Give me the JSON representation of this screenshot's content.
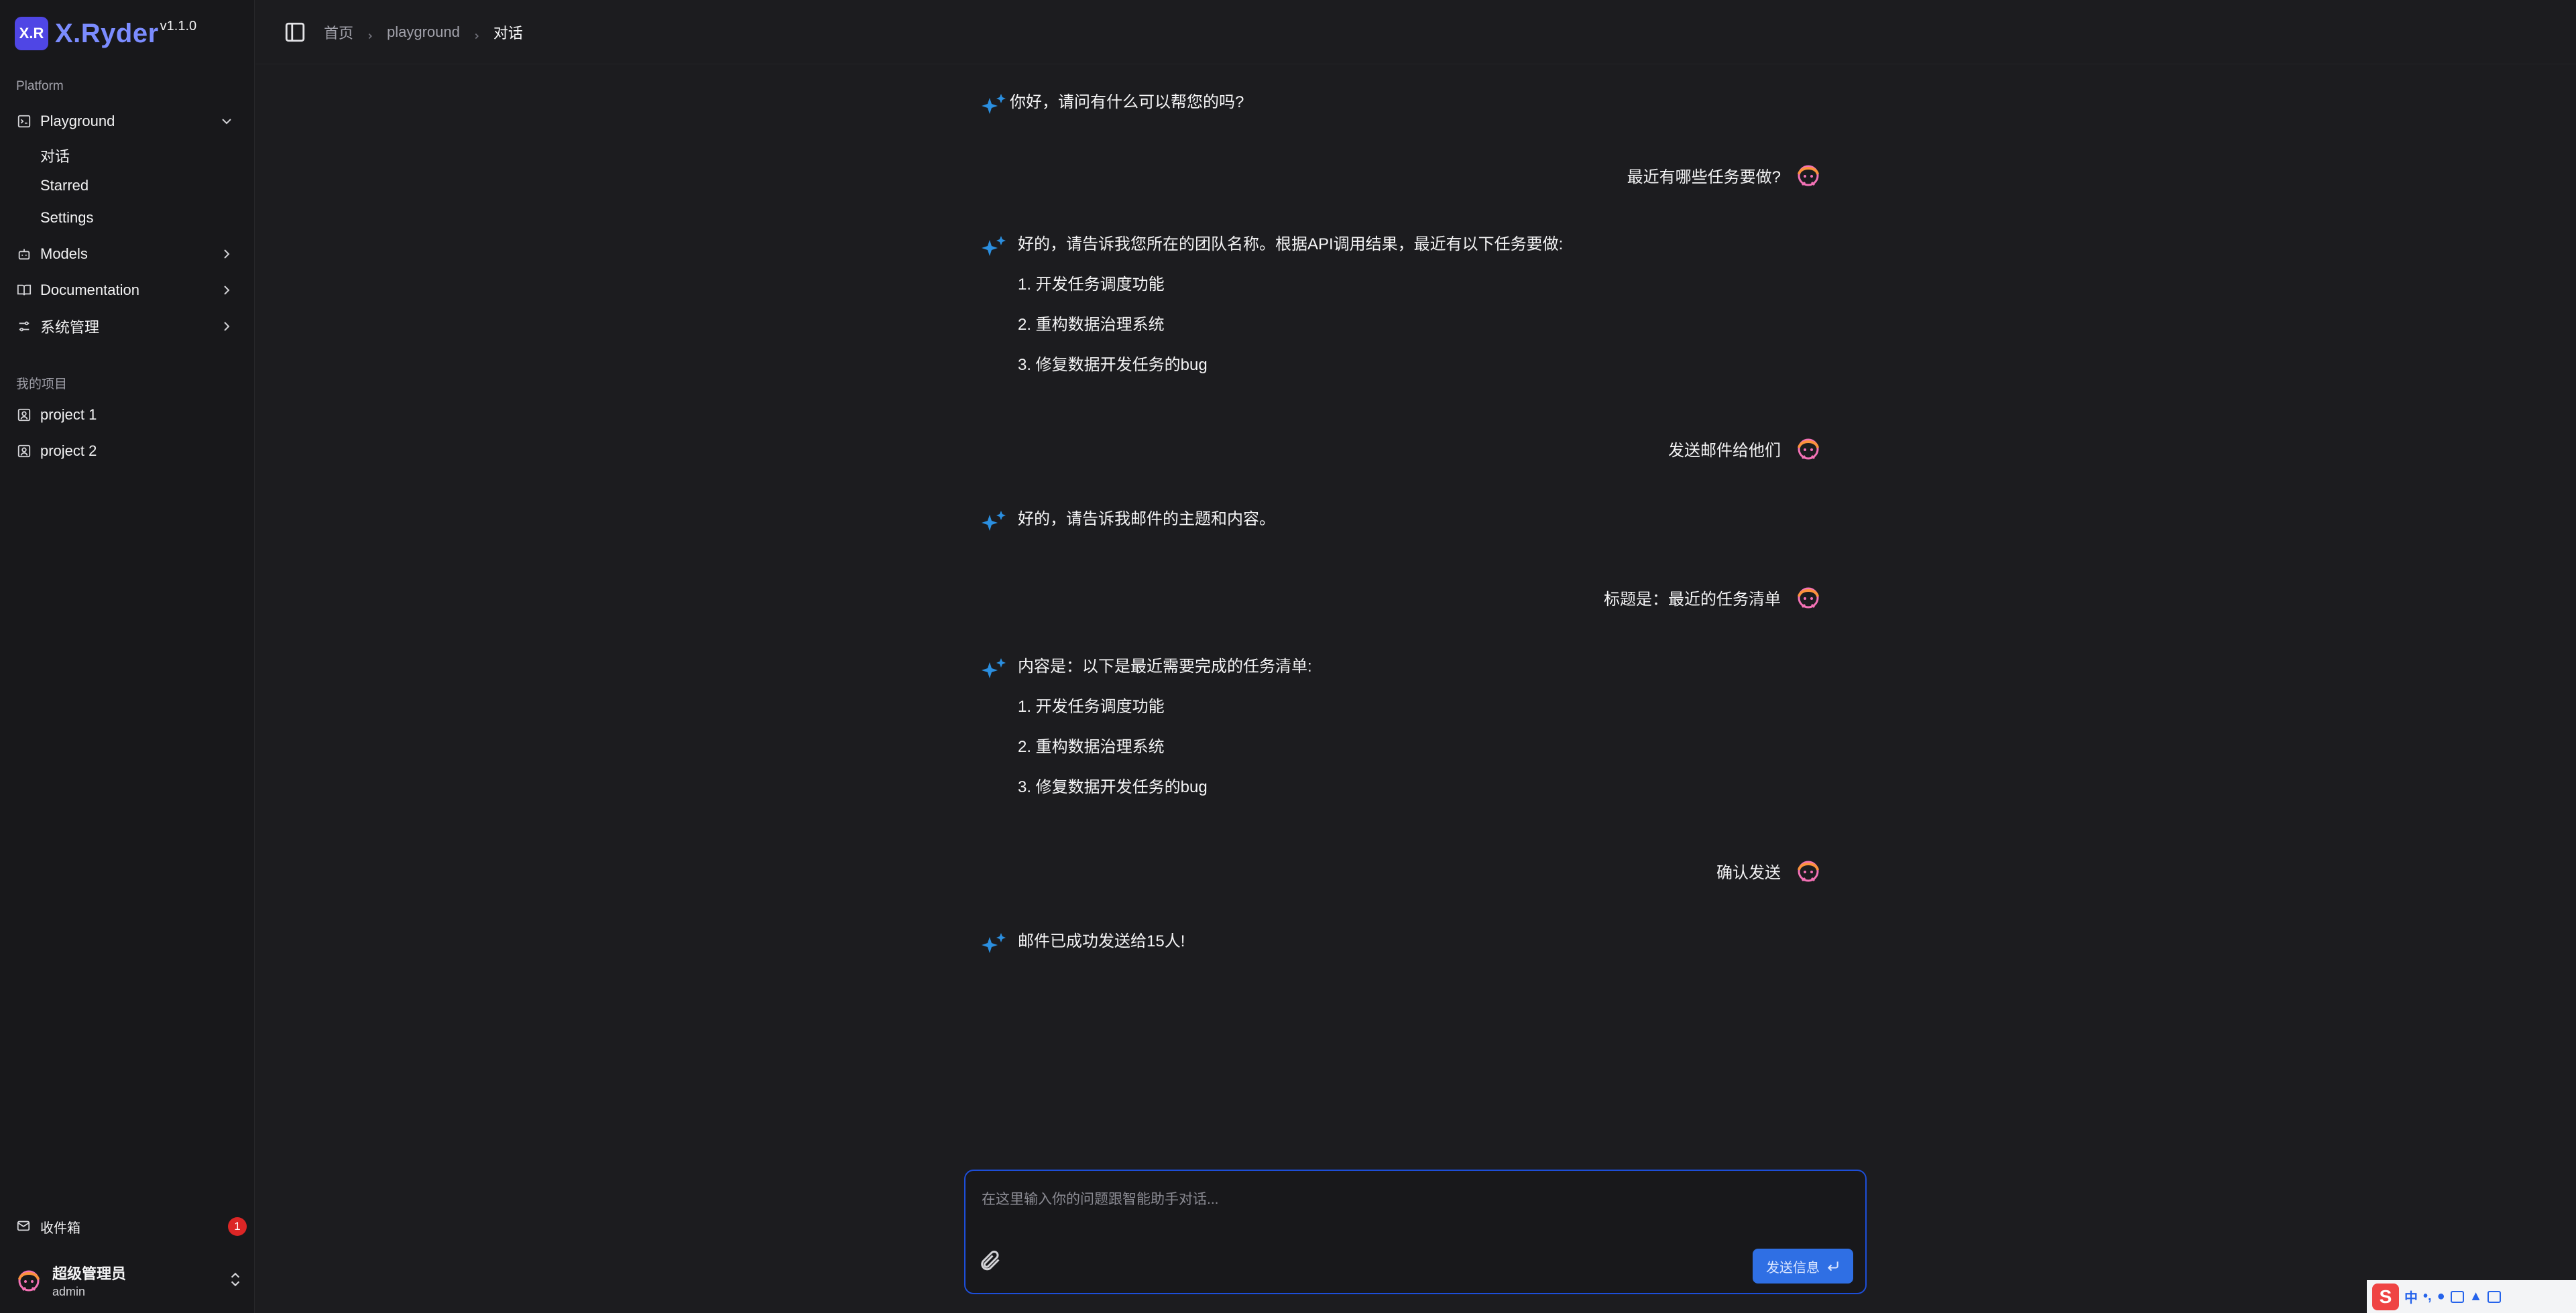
{
  "brand": {
    "logo_text": "X.R",
    "name": "X.Ryder",
    "version": "v1.1.0"
  },
  "sidebar": {
    "platform_label": "Platform",
    "playground": {
      "label": "Playground",
      "icon": "terminal-square-icon",
      "expanded": true,
      "children": [
        "对话",
        "Starred",
        "Settings"
      ]
    },
    "models": {
      "label": "Models",
      "icon": "bot-icon"
    },
    "documentation": {
      "label": "Documentation",
      "icon": "book-open-icon"
    },
    "system": {
      "label": "系统管理",
      "icon": "sliders-icon"
    },
    "projects_label": "我的项目",
    "projects": [
      "project 1",
      "project 2"
    ],
    "inbox": {
      "label": "收件箱",
      "count": "1"
    },
    "user": {
      "name": "超级管理员",
      "role": "admin"
    }
  },
  "header": {
    "breadcrumbs": [
      "首页",
      "playground",
      "对话"
    ]
  },
  "messages": [
    {
      "role": "assistant",
      "lines": [
        "你好，请问有什么可以帮您的吗?"
      ]
    },
    {
      "role": "user",
      "text": "最近有哪些任务要做?"
    },
    {
      "role": "assistant",
      "lines": [
        "好的，请告诉我您所在的团队名称。根据API调用结果，最近有以下任务要做:",
        "1. 开发任务调度功能",
        "2. 重构数据治理系统",
        "3. 修复数据开发任务的bug"
      ]
    },
    {
      "role": "user",
      "text": "发送邮件给他们"
    },
    {
      "role": "assistant",
      "lines": [
        "好的，请告诉我邮件的主题和内容。"
      ]
    },
    {
      "role": "user",
      "text": "标题是：最近的任务清单"
    },
    {
      "role": "assistant",
      "lines": [
        "内容是：以下是最近需要完成的任务清单:",
        "1. 开发任务调度功能",
        "2. 重构数据治理系统",
        "3. 修复数据开发任务的bug"
      ]
    },
    {
      "role": "user",
      "text": "确认发送"
    },
    {
      "role": "assistant",
      "lines": [
        "邮件已成功发送给15人!"
      ]
    }
  ],
  "composer": {
    "placeholder": "在这里输入你的问题跟智能助手对话...",
    "value": "",
    "send_label": "发送信息"
  },
  "ime": {
    "logo": "S",
    "mode": "中"
  },
  "colors": {
    "accent": "#2f6fe4",
    "brand": "#7b8cff",
    "badge": "#dc2626",
    "sparkle": "#2b8fe0",
    "background": "#1c1c1f"
  }
}
